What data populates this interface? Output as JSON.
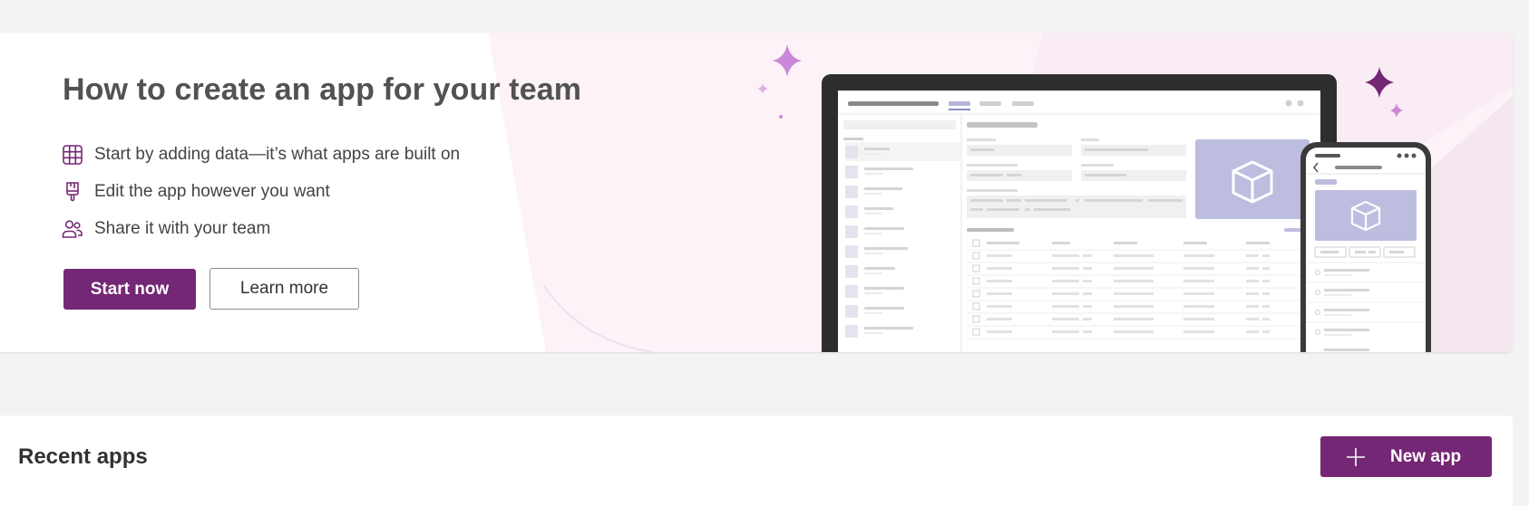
{
  "hero": {
    "title": "How to create an app for your team",
    "bullets": [
      {
        "icon": "table-icon",
        "text": "Start by adding data—it’s what apps are built on"
      },
      {
        "icon": "paintbrush-icon",
        "text": "Edit the app however you want"
      },
      {
        "icon": "people-icon",
        "text": "Share it with your team"
      }
    ],
    "start_label": "Start now",
    "learn_label": "Learn more"
  },
  "recent": {
    "title": "Recent apps",
    "new_app_label": "New app"
  },
  "colors": {
    "brand": "#742774",
    "sparkle_light": "#cc88d8",
    "illustration_accent": "#bdbde0"
  }
}
